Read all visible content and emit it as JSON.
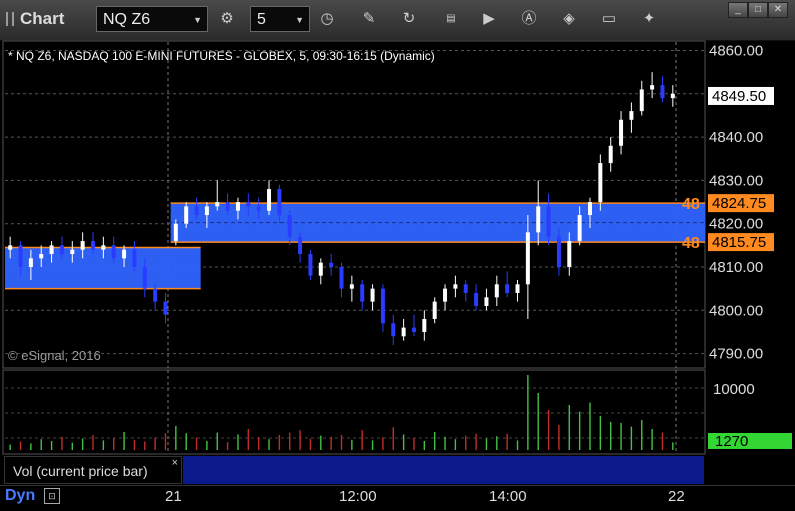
{
  "toolbar": {
    "app_title": "Chart",
    "symbol": "NQ Z6",
    "interval": "5"
  },
  "chart": {
    "header": "* NQ Z6, NASDAQ 100 E-MINI FUTURES - GLOBEX, 5, 09:30-16:15 (Dynamic)",
    "copyright": "© eSignal, 2016",
    "price_ticks": [
      "4860.00",
      "4850.00",
      "4840.00",
      "4830.00",
      "4820.00",
      "4810.00",
      "4800.00",
      "4790.00"
    ],
    "last_price": "4849.50",
    "zone_upper_label": "48",
    "zone_upper_price": "4824.75",
    "zone_lower_label": "48",
    "zone_lower_price": "4815.75",
    "volume_tick": "10000",
    "volume_last": "1270",
    "time_ticks": [
      "21",
      "12:00",
      "14:00",
      "22"
    ]
  },
  "volume_legend": {
    "label": "Vol (current price bar)",
    "close": "×"
  },
  "bottom": {
    "mode": "Dyn"
  },
  "chart_data": {
    "type": "candlestick",
    "series": [
      {
        "name": "NQ Z6",
        "candles": [
          [
            4814,
            4817,
            4812,
            4815
          ],
          [
            4815,
            4816,
            4808,
            4810
          ],
          [
            4810,
            4814,
            4807,
            4812
          ],
          [
            4812,
            4815,
            4810,
            4813
          ],
          [
            4813,
            4816,
            4811,
            4815
          ],
          [
            4815,
            4817,
            4812,
            4813
          ],
          [
            4813,
            4816,
            4811,
            4814
          ],
          [
            4814,
            4818,
            4812,
            4816
          ],
          [
            4816,
            4818,
            4813,
            4814
          ],
          [
            4814,
            4817,
            4812,
            4815
          ],
          [
            4815,
            4817,
            4811,
            4812
          ],
          [
            4812,
            4815,
            4810,
            4814
          ],
          [
            4814,
            4816,
            4809,
            4810
          ],
          [
            4810,
            4812,
            4803,
            4805
          ],
          [
            4805,
            4806,
            4800,
            4802
          ],
          [
            4802,
            4804,
            4797,
            4799
          ],
          [
            4816,
            4821,
            4815,
            4820
          ],
          [
            4820,
            4825,
            4819,
            4824
          ],
          [
            4824,
            4826,
            4821,
            4822
          ],
          [
            4822,
            4825,
            4819,
            4824
          ],
          [
            4824,
            4830,
            4823,
            4825
          ],
          [
            4825,
            4827,
            4822,
            4823
          ],
          [
            4823,
            4826,
            4821,
            4825
          ],
          [
            4825,
            4827,
            4822,
            4824
          ],
          [
            4824,
            4826,
            4821,
            4823
          ],
          [
            4823,
            4830,
            4822,
            4828
          ],
          [
            4828,
            4829,
            4820,
            4822
          ],
          [
            4822,
            4823,
            4815,
            4817
          ],
          [
            4817,
            4818,
            4811,
            4813
          ],
          [
            4813,
            4814,
            4807,
            4808
          ],
          [
            4808,
            4812,
            4806,
            4811
          ],
          [
            4811,
            4813,
            4808,
            4810
          ],
          [
            4810,
            4811,
            4803,
            4805
          ],
          [
            4805,
            4808,
            4802,
            4806
          ],
          [
            4806,
            4807,
            4800,
            4802
          ],
          [
            4802,
            4806,
            4800,
            4805
          ],
          [
            4805,
            4806,
            4795,
            4797
          ],
          [
            4797,
            4799,
            4792,
            4794
          ],
          [
            4794,
            4798,
            4793,
            4796
          ],
          [
            4796,
            4799,
            4794,
            4795
          ],
          [
            4795,
            4800,
            4793,
            4798
          ],
          [
            4798,
            4803,
            4797,
            4802
          ],
          [
            4802,
            4806,
            4800,
            4805
          ],
          [
            4805,
            4808,
            4803,
            4806
          ],
          [
            4806,
            4807,
            4802,
            4804
          ],
          [
            4804,
            4806,
            4800,
            4801
          ],
          [
            4801,
            4805,
            4800,
            4803
          ],
          [
            4803,
            4808,
            4801,
            4806
          ],
          [
            4806,
            4809,
            4803,
            4804
          ],
          [
            4804,
            4807,
            4802,
            4806
          ],
          [
            4806,
            4822,
            4798,
            4818
          ],
          [
            4818,
            4830,
            4815,
            4824
          ],
          [
            4824,
            4827,
            4815,
            4817
          ],
          [
            4817,
            4819,
            4808,
            4810
          ],
          [
            4810,
            4818,
            4808,
            4816
          ],
          [
            4816,
            4824,
            4815,
            4822
          ],
          [
            4822,
            4826,
            4819,
            4825
          ],
          [
            4825,
            4836,
            4823,
            4834
          ],
          [
            4834,
            4840,
            4832,
            4838
          ],
          [
            4838,
            4846,
            4836,
            4844
          ],
          [
            4844,
            4848,
            4841,
            4846
          ],
          [
            4846,
            4853,
            4845,
            4851
          ],
          [
            4851,
            4855,
            4849,
            4852
          ],
          [
            4852,
            4854,
            4848,
            4849
          ],
          [
            4849,
            4852,
            4847,
            4850
          ]
        ]
      }
    ],
    "zones": [
      {
        "top": 4814.5,
        "bottom": 4805,
        "x_start": 0,
        "x_end": 16
      },
      {
        "top": 4824.75,
        "bottom": 4815.75,
        "x_start": 16,
        "x_end": 65
      }
    ],
    "volume_ylim": [
      0,
      13000
    ],
    "volume": [
      900,
      1400,
      1100,
      1800,
      1500,
      2200,
      1200,
      1900,
      2500,
      1600,
      2000,
      3000,
      1700,
      1400,
      2100,
      2800,
      4000,
      2800,
      2100,
      1500,
      2900,
      1300,
      2600,
      3500,
      2100,
      1800,
      2500,
      2900,
      3300,
      1900,
      2400,
      2200,
      2500,
      1700,
      3300,
      1600,
      2100,
      3800,
      2600,
      2000,
      1500,
      3000,
      2200,
      1800,
      2400,
      2700,
      1900,
      2300,
      2700,
      1600,
      12500,
      9500,
      6700,
      4200,
      7500,
      6400,
      7900,
      5700,
      4700,
      4500,
      3900,
      5000,
      3500,
      2900,
      1270
    ]
  }
}
